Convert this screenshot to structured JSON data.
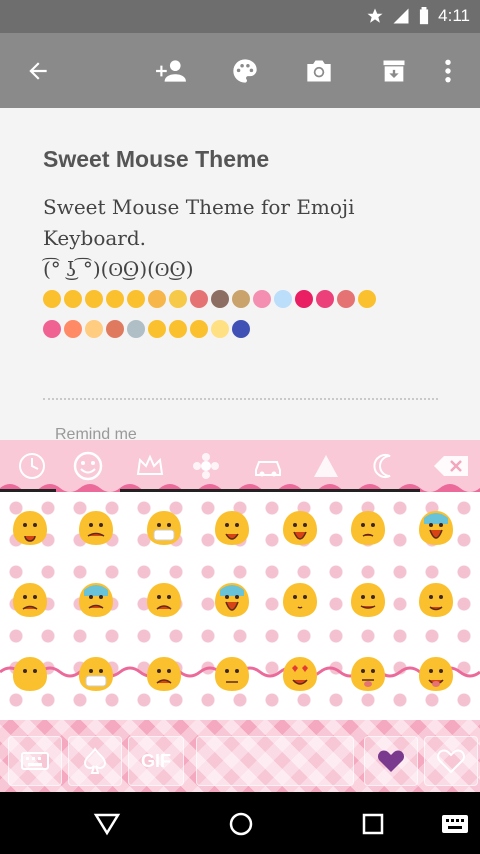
{
  "status_bar": {
    "time": "4:11",
    "icons": [
      "star-icon",
      "signal-icon",
      "battery-icon"
    ]
  },
  "toolbar": {
    "icons": [
      "back-arrow-icon",
      "add-person-icon",
      "palette-icon",
      "camera-icon",
      "archive-icon",
      "more-vert-icon"
    ]
  },
  "note": {
    "title": "Sweet Mouse Theme",
    "body": "Sweet Mouse Theme for Emoji\nKeyboard.\n(͡° ͜ʖ ͡°)(ʘ͜ʘ)(ʘ͜ʘ)",
    "remind": "Remind me"
  },
  "keyboard": {
    "category_icons": [
      "clock-icon",
      "smiley-icon",
      "crown-icon",
      "flower-icon",
      "car-icon",
      "triangle-icon",
      "moon-icon",
      "backspace-icon"
    ],
    "gif_label": "GIF",
    "emoji_rows": [
      [
        "blob-surprised",
        "blob-angry",
        "blob-mask-angry",
        "blob-sad-open",
        "blob-shout",
        "blob-worried",
        "blob-scream-blue"
      ],
      [
        "blob-tear",
        "blob-cold-sweat",
        "blob-frown",
        "blob-fearful",
        "blob-whistle",
        "blob-relieved",
        "blob-dizzy"
      ],
      [
        "blob-no-mouth",
        "blob-mask",
        "blob-frown-2",
        "blob-unamused",
        "blob-heart-eyes",
        "blob-tongue",
        "blob-wink-tongue"
      ]
    ]
  },
  "colors": {
    "toolbar": "#8a8a8a",
    "keyboard_pink": "#f9c9d8",
    "emoji_yellow": "#fbc02d"
  }
}
